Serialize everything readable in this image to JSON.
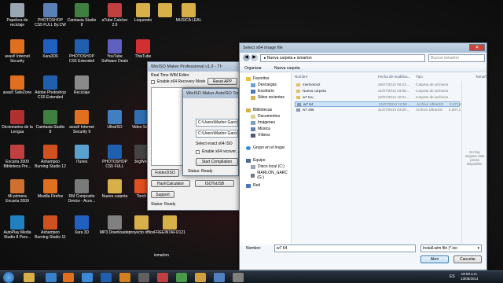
{
  "desktop_icons": [
    {
      "label": "Papelera de reciclaje",
      "color": "#9aa7b3"
    },
    {
      "label": "PHOTOSHOP CS5 FULL By.CW",
      "color": "#5a80b8"
    },
    {
      "label": "Camtasia Studio 8",
      "color": "#3f7f3f"
    },
    {
      "label": "aTube Catcher 2.9",
      "color": "#c24040"
    },
    {
      "label": "Loquendo",
      "color": "#d8b04a"
    },
    {
      "label": "",
      "color": "#d8b04a"
    },
    {
      "label": "MUSICA LEAL",
      "color": "#d8b04a"
    },
    {
      "label": "avast! Internet Security",
      "color": "#e07020"
    },
    {
      "label": "Xara3D6",
      "color": "#2060c0"
    },
    {
      "label": "PHOTOSHOP CS5 Extended",
      "color": "#1f5fae"
    },
    {
      "label": "YouTube Software Deals",
      "color": "#6060c0"
    },
    {
      "label": "ThisTube",
      "color": "#d03030"
    },
    {
      "label": "avast! SafeZone",
      "color": "#e07020"
    },
    {
      "label": "Adobe Photoshop CS5 Extended",
      "color": "#1f5fae"
    },
    {
      "label": "Reciclaje",
      "color": "#8a8a8a"
    },
    {
      "label": "Diccionarios de la Lengua",
      "color": "#b03030"
    },
    {
      "label": "Camtasia Studio 8",
      "color": "#3f7f3f"
    },
    {
      "label": "avast! Internet Security 9",
      "color": "#e07020"
    },
    {
      "label": "UltraISO",
      "color": "#4080c0"
    },
    {
      "label": "Video Se...",
      "color": "#3070b0"
    },
    {
      "label": "Encarta 2009 Biblioteca Pre...",
      "color": "#c04040"
    },
    {
      "label": "Ashampoo Burning Studio 12",
      "color": "#d05020"
    },
    {
      "label": "iTunes",
      "color": "#5aa0d0"
    },
    {
      "label": "PHOTOSHOP CS5 FULL",
      "color": "#1f5fae"
    },
    {
      "label": "3ngWeb",
      "color": "#444"
    },
    {
      "label": "Mi primera Encarta 2009",
      "color": "#d07030"
    },
    {
      "label": "Mozilla Firefox",
      "color": "#e07020"
    },
    {
      "label": "RM Composite Device - Acce...",
      "color": "#7a7a7a"
    },
    {
      "label": "Nueva carpeta",
      "color": "#d8b04a"
    },
    {
      "label": "Torch",
      "color": "#e05020"
    },
    {
      "label": "AutoPlay Media Studio 8 Pers...",
      "color": "#2080c0"
    },
    {
      "label": "Ashampoo Burning Studio 11",
      "color": "#d05020"
    },
    {
      "label": "Xara 3D",
      "color": "#2060c0"
    },
    {
      "label": "MP3 Downloader",
      "color": "#808080"
    },
    {
      "label": "proyecto office",
      "color": "#d8b04a"
    },
    {
      "label": "FREEINTAFI2121",
      "color": "#d8b04a"
    }
  ],
  "desktop_text": {
    "ismarlon": "ismarlon"
  },
  "winiso_window": {
    "title": "WinISO Maker Professional v1.3 - The all in One W...",
    "section": "Real Time WIM Editor",
    "checkbox_label": "Enable x64 Recovery Mode",
    "reset_label": "Reset APP",
    "folder2iso": "Folder2ISO",
    "hash": "HashCalculator",
    "iso2usb": "ISOToUSB",
    "support": "Support",
    "status_label": "Status:",
    "status_value": "Ready"
  },
  "autoiso_window": {
    "title": "WinISO Maker AutoISO Tool",
    "path1": "C:\\Users\\Marlon Garcia",
    "path2": "C:\\Users\\Marlon Garcia",
    "select_label": "Select exact x64 ISO",
    "enable_label": "Enable x64 recover...",
    "start_label": "Start Compilation",
    "status_label": "Status:",
    "status_value": "Ready"
  },
  "file_dialog": {
    "title": "Select x64 image file",
    "breadcrumb": [
      "Nueva carpeta",
      "ismarlon"
    ],
    "search_placeholder": "Buscar ismarlon",
    "organize": "Organizar",
    "new_folder": "Nueva carpeta",
    "columns": [
      "Nombre",
      "Fecha de modifica...",
      "Tipo",
      "Tamaño"
    ],
    "nav": {
      "favorites": "Favoritos",
      "fav_items": [
        "Descargas",
        "Escritorio",
        "Sitios recientes"
      ],
      "libraries": "Bibliotecas",
      "lib_items": [
        "Documentos",
        "Imágenes",
        "Música",
        "Vídeos"
      ],
      "homegroup": "Grupo en el hogar",
      "computer": "Equipo",
      "comp_items": [
        "Disco local (C:)",
        "MARLON_GARC (G:)"
      ],
      "network": "Red"
    },
    "rows": [
      {
        "name": "merlonios2",
        "date": "26/07/2014 05:23 ...",
        "type": "Carpeta de archivos",
        "size": ""
      },
      {
        "name": "Nueva carpeta",
        "date": "21/07/2014 03:08 ...",
        "type": "Carpeta de archivos",
        "size": ""
      },
      {
        "name": "w7 teu",
        "date": "22/07/2014 10:01 ...",
        "type": "Carpeta de archivos",
        "size": ""
      },
      {
        "name": "w7 64",
        "date": "21/07/2014 12:56 ...",
        "type": "Archivo UltraISO",
        "size": "2,571,4"
      },
      {
        "name": "w7 x86",
        "date": "21/07/2014 03:08 ...",
        "type": "Archivo UltraISO",
        "size": "2,507,1"
      }
    ],
    "preview_text": "No hay ninguna vista previa disponible.",
    "filename_label": "Nombre:",
    "filename_value": "w7 64",
    "filter_value": "Install.wim file (*.iso",
    "open": "Abrir",
    "cancel": "Cancelar"
  },
  "taskbar": {
    "lang": "ES",
    "time": "19:09 a.m.",
    "date": "13/08/2014"
  }
}
